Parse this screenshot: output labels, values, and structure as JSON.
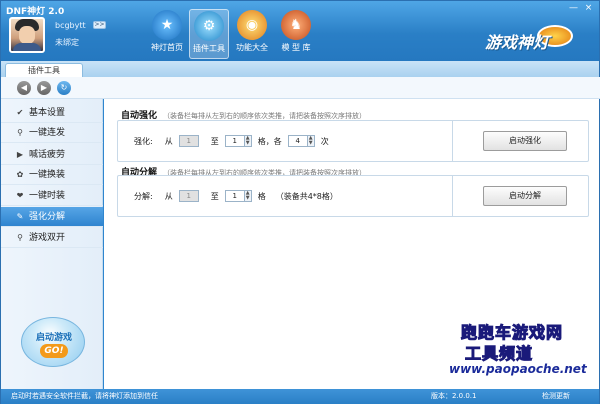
{
  "window": {
    "title": "DNF神灯 2.0",
    "minimize": "—",
    "close": "×"
  },
  "user": {
    "name": "bcgbytt",
    "status": "未绑定",
    "switch_label": ">>"
  },
  "nav": [
    {
      "label": "神灯首页",
      "icon": "star-icon"
    },
    {
      "label": "插件工具",
      "icon": "gear-icon"
    },
    {
      "label": "功能大全",
      "icon": "orbit-icon"
    },
    {
      "label": "模 型 库",
      "icon": "character-icon"
    }
  ],
  "brand": {
    "logo_text": "游戏神灯"
  },
  "tab": {
    "label": "插件工具"
  },
  "sidebar": {
    "items": [
      {
        "label": "基本设置",
        "icon": "check-icon",
        "glyph": "✔"
      },
      {
        "label": "一键连发",
        "icon": "key-icon",
        "glyph": "⚲"
      },
      {
        "label": "喊话疲劳",
        "icon": "triangle-icon",
        "glyph": "▶"
      },
      {
        "label": "一键换装",
        "icon": "paw-icon",
        "glyph": "✿"
      },
      {
        "label": "一键时装",
        "icon": "heart-icon",
        "glyph": "❤"
      },
      {
        "label": "强化分解",
        "icon": "wrench-icon",
        "glyph": "✎"
      },
      {
        "label": "游戏双开",
        "icon": "key-icon",
        "glyph": "⚲"
      }
    ],
    "active_index": 5,
    "start_game": {
      "label": "启动游戏",
      "go": "GO!"
    }
  },
  "strengthen": {
    "title": "自动强化",
    "note": "（装备栏每排从左到右的顺序依次类推，请把装备按照次序排放）",
    "row_label": "强化:",
    "from_label": "从",
    "from_value": "1",
    "to_label": "至",
    "to_value": "1",
    "each_label": "格，各",
    "level_value": "4",
    "times_label": "次",
    "button": "启动强化"
  },
  "decompose": {
    "title": "自动分解",
    "note": "（装备栏每排从左到右的顺序依次类推，请把装备按照次序排放）",
    "row_label": "分解:",
    "from_label": "从",
    "from_value": "1",
    "to_label": "至",
    "to_value": "1",
    "grid_label": "格",
    "hint": "（装备共4*8格）",
    "button": "启动分解"
  },
  "watermark": {
    "line1": "跑跑车游戏网",
    "line2": "工具频道",
    "url": "www.paopaoche.net"
  },
  "status": {
    "message": "启动时若遇安全软件拦截，请将神灯添加到信任",
    "version_label": "版本：",
    "version": "2.0.0.1",
    "check_update": "检测更新"
  }
}
